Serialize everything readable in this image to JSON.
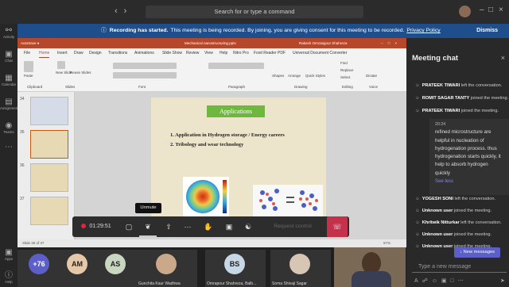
{
  "titlebar": {
    "search_placeholder": "Search for or type a command",
    "back_icon": "arrow-left-icon",
    "forward_icon": "arrow-right-icon"
  },
  "rail": [
    {
      "label": "Activity",
      "icon": "bell-icon"
    },
    {
      "label": "Chat",
      "icon": "chat-icon"
    },
    {
      "label": "Calendar",
      "icon": "calendar-icon"
    },
    {
      "label": "Assignments",
      "icon": "assignments-icon"
    },
    {
      "label": "Teams",
      "icon": "teams-icon"
    },
    {
      "label": "Apps",
      "icon": "apps-icon"
    },
    {
      "label": "Help",
      "icon": "help-icon"
    }
  ],
  "banner": {
    "title": "Recording has started.",
    "text": "This meeting is being recorded. By joining, you are giving consent for this meeting to be recorded.",
    "link": "Privacy Policy",
    "dismiss": "Dismiss"
  },
  "ppt": {
    "doc_title": "Mechanical nanostructuring.pptx",
    "presenter": "Rakesh Omrasigour Shahreza",
    "tabs": [
      "File",
      "Home",
      "Insert",
      "Draw",
      "Design",
      "Transitions",
      "Animations",
      "Slide Show",
      "Review",
      "View",
      "Help",
      "Nitro Pro",
      "Foxit Reader PDF",
      "Universal Document Converter"
    ],
    "ribbon": [
      "Paste",
      "New Slide",
      "Reuse Slides",
      "Shapes",
      "Arrange",
      "Quick Styles",
      "Find",
      "Replace",
      "Select",
      "Dictate"
    ],
    "groups": [
      "Clipboard",
      "Slides",
      "Font",
      "Paragraph",
      "Drawing",
      "Editing",
      "Voice"
    ],
    "slide_numbers": [
      "34",
      "35",
      "36",
      "37"
    ],
    "slide_title": "Applications",
    "slide_items": [
      "1.  Application in Hydrogen storage / Energy careers",
      "2.  Tribology and wear technology"
    ],
    "status_left": "Slide 35 of 37",
    "status_right": "67%"
  },
  "chat": {
    "title": "Meeting chat",
    "events": [
      {
        "name": "PRATEEK TIWARI",
        "text": "left the conversation."
      },
      {
        "name": "ROMIT SAGAR TANTY",
        "text": "joined the meeting."
      },
      {
        "name": "PRATEEK TIWARI",
        "text": "joined the meeting."
      },
      {
        "name": "YOGESH SONI",
        "text": "left the conversation."
      },
      {
        "name": "Unknown user",
        "text": "joined the meeting."
      },
      {
        "name": "Khritwik Nitturkar",
        "text": "left the conversation."
      },
      {
        "name": "Unknown user",
        "text": "joined the meeting."
      },
      {
        "name": "Unknown user",
        "text": "joined the meeting."
      }
    ],
    "message": {
      "time": "20:24",
      "text": "refined microstructure are helpful in nucleation of hydrogenation process. thus hydrogenation starts quickly, it help to absorb hydrogen quickly",
      "see_less": "See less"
    },
    "new_messages": "New messages",
    "compose_placeholder": "Type a new message"
  },
  "toolbar": {
    "timer": "01:29:51",
    "request_control": "Request control",
    "tooltip": "Unmute"
  },
  "participants": [
    {
      "initials": "+76",
      "name": "",
      "color": "#5b5fc7"
    },
    {
      "initials": "AM",
      "name": "",
      "color": "#e5c8a8"
    },
    {
      "initials": "AS",
      "name": "",
      "color": "#c9d6c0"
    },
    {
      "initials": "",
      "name": "Gunchita Kaur Wadhwa",
      "color": "#caa98b"
    },
    {
      "initials": "BS",
      "name": "Omrapour Shahreza, Balb...",
      "color": "#c8d7e6"
    },
    {
      "initials": "",
      "name": "Soma Shivaji Sagar",
      "color": "#d7c6b4"
    }
  ]
}
